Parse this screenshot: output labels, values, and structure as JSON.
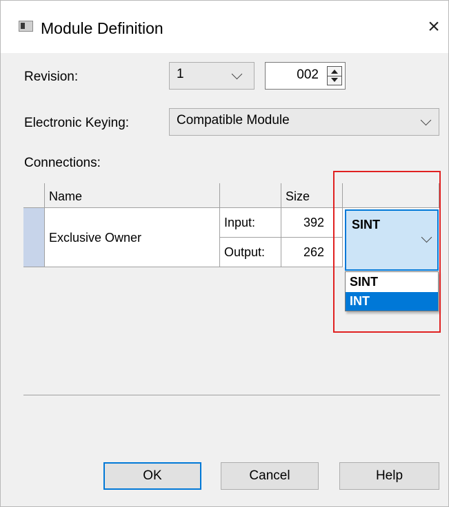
{
  "window": {
    "title": "Module Definition",
    "close_glyph": "×"
  },
  "revision": {
    "label": "Revision:",
    "major": "1",
    "minor": "002"
  },
  "keying": {
    "label": "Electronic Keying:",
    "value": "Compatible Module"
  },
  "connections": {
    "label": "Connections:",
    "headers": {
      "name": "Name",
      "size": "Size"
    },
    "row": {
      "name": "Exclusive Owner",
      "input_label": "Input:",
      "input_size": "392",
      "output_label": "Output:",
      "output_size": "262",
      "data_type": "SINT"
    },
    "data_type_options": [
      "SINT",
      "INT"
    ],
    "highlighted_option": "INT"
  },
  "buttons": {
    "ok": "OK",
    "cancel": "Cancel",
    "help": "Help"
  },
  "colors": {
    "accent": "#0078d7",
    "annotation": "#e02020",
    "selection_bg": "#cce4f7",
    "row_selector": "#c7d4ea"
  },
  "icons": [
    "window-icon",
    "close-icon",
    "chevron-down-icon",
    "spinner-up-icon",
    "spinner-down-icon"
  ]
}
